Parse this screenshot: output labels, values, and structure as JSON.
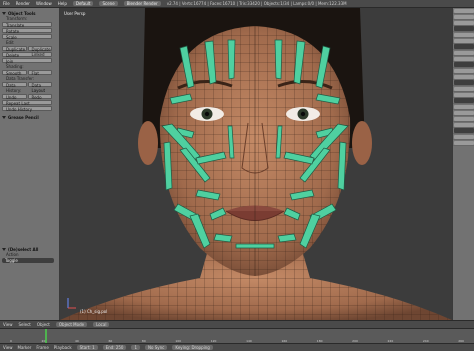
{
  "topbar": {
    "menus": [
      "File",
      "Render",
      "Window",
      "Help"
    ],
    "screen": "Default",
    "scene": "Scene",
    "engine": "Blender Render",
    "stats": "v2.74 | Verts:16774 | Faces:16710 | Tris:33420 | Objects:1/34 | Lamps:0/0 | Mem:122.33M"
  },
  "toolshelf": {
    "header": "Object Tools",
    "transform_label": "Transform:",
    "transform_buttons": [
      "Translate",
      "Rotate",
      "Scale"
    ],
    "edit_label": "Edit",
    "edit_pair_1": [
      "Duplicate",
      "Duplicate Linked"
    ],
    "delete_label": "Delete",
    "join_label": "Join",
    "shading_label": "Shading:",
    "shading_pair": [
      "Smooth",
      "Flat"
    ],
    "data_label": "Data Transfer:",
    "data_pair": [
      "Data",
      "Data Layout"
    ],
    "history_label": "History:",
    "history_pair": [
      "Undo",
      "Redo"
    ],
    "repeat_label": "Repeat Last",
    "history_btn": "Undo History",
    "grease_header": "Grease Pencil",
    "panel2_header": "(De)select All",
    "action_label": "Action",
    "action_value": "Toggle"
  },
  "viewport": {
    "label": "User Persp",
    "object_label": "(1) Ch_sig.pol"
  },
  "vheader": {
    "items": [
      "View",
      "Select",
      "Object"
    ],
    "mode": "Object Mode",
    "pivot": "Local"
  },
  "timeline": {
    "ticks": [
      "0",
      "20",
      "40",
      "60",
      "80",
      "100",
      "120",
      "140",
      "160",
      "180",
      "200",
      "220",
      "240",
      "260"
    ]
  },
  "tlheader": {
    "items": [
      "View",
      "Marker",
      "Frame",
      "Playback"
    ],
    "start_label": "Start:",
    "start_value": "1",
    "end_label": "End:",
    "end_value": "250",
    "current_value": "1",
    "sync": "No Sync",
    "keying": "Keying: Dropping"
  },
  "colors": {
    "accent": "#4fd0a0",
    "skin": "#b07a5a",
    "hair": "#1a1410",
    "background": "#3c3c3c"
  }
}
